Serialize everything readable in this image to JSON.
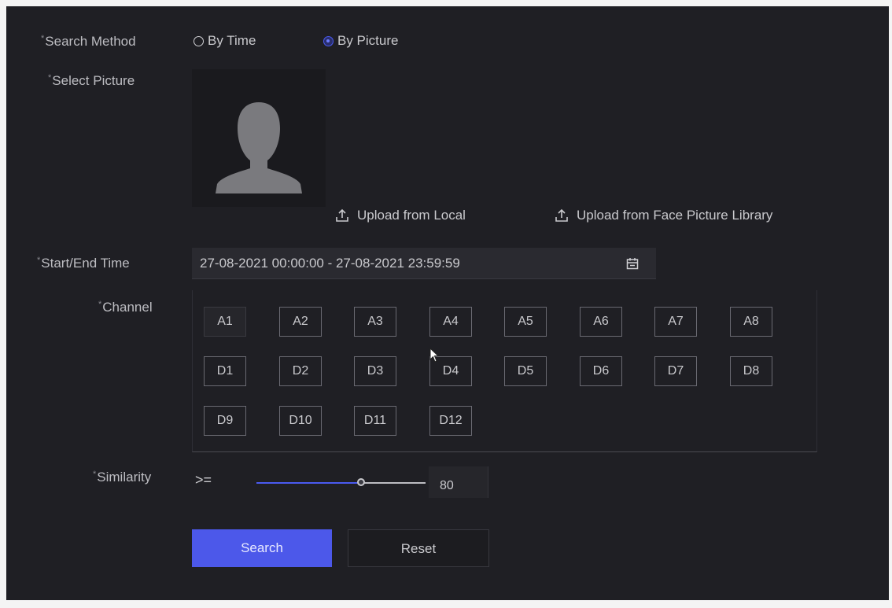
{
  "search_method": {
    "label": "Search Method",
    "options": [
      {
        "label": "By Time",
        "checked": false
      },
      {
        "label": "By Picture",
        "checked": true
      }
    ]
  },
  "select_picture": {
    "label": "Select Picture",
    "upload_local": "Upload from Local",
    "upload_library": "Upload from Face Picture Library"
  },
  "time": {
    "label": "Start/End Time",
    "value": "27-08-2021 00:00:00 - 27-08-2021 23:59:59",
    "icon": "calendar-icon"
  },
  "channel": {
    "label": "Channel",
    "rows": [
      [
        "A1",
        "A2",
        "A3",
        "A4",
        "A5",
        "A6",
        "A7",
        "A8"
      ],
      [
        "D1",
        "D2",
        "D3",
        "D4",
        "D5",
        "D6",
        "D7",
        "D8"
      ],
      [
        "D9",
        "D10",
        "D11",
        "D12"
      ]
    ]
  },
  "similarity": {
    "label": "Similarity",
    "operator": ">=",
    "value": "80",
    "slider_fraction": 0.62
  },
  "buttons": {
    "search": "Search",
    "reset": "Reset"
  },
  "colors": {
    "accent": "#4c58ea",
    "background": "#1f1f24"
  }
}
